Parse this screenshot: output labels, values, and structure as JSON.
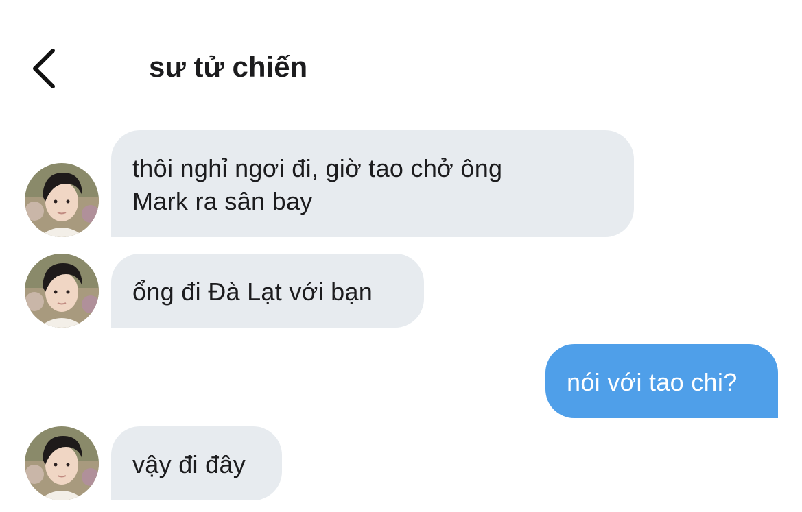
{
  "header": {
    "title": "sư tử chiến",
    "back_icon": "chevron-left-icon"
  },
  "colors": {
    "incoming_bubble": "#e7ebef",
    "outgoing_bubble": "#4f9fe9",
    "text": "#1c1c1e",
    "outgoing_text": "#ffffff"
  },
  "messages": [
    {
      "direction": "incoming",
      "lines": [
        "thôi nghỉ ngơi đi, giờ tao chở ông",
        "Mark ra sân bay"
      ],
      "avatar": "contact-avatar"
    },
    {
      "direction": "incoming",
      "lines": [
        "ổng đi Đà Lạt với bạn"
      ],
      "avatar": "contact-avatar"
    },
    {
      "direction": "outgoing",
      "lines": [
        "nói với tao chi?"
      ]
    },
    {
      "direction": "incoming",
      "lines": [
        "vậy đi đây"
      ],
      "avatar": "contact-avatar"
    }
  ]
}
